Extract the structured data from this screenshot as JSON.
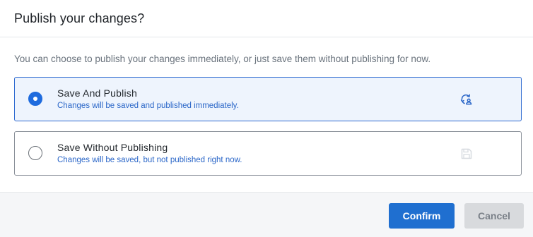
{
  "dialog": {
    "title": "Publish your changes?",
    "description": "You can choose to publish your changes immediately, or just save them without publishing for now."
  },
  "options": [
    {
      "title": "Save And Publish",
      "subtitle": "Changes will be saved and published immediately.",
      "selected": true,
      "icon": "sync-publish-icon"
    },
    {
      "title": "Save Without Publishing",
      "subtitle": "Changes will be saved, but not published right now.",
      "selected": false,
      "icon": "save-disk-icon"
    }
  ],
  "footer": {
    "confirm_label": "Confirm",
    "cancel_label": "Cancel"
  },
  "colors": {
    "accent": "#1f6fd0",
    "selected_background": "#eef4fd",
    "subtitle_blue": "#2a66c8"
  }
}
